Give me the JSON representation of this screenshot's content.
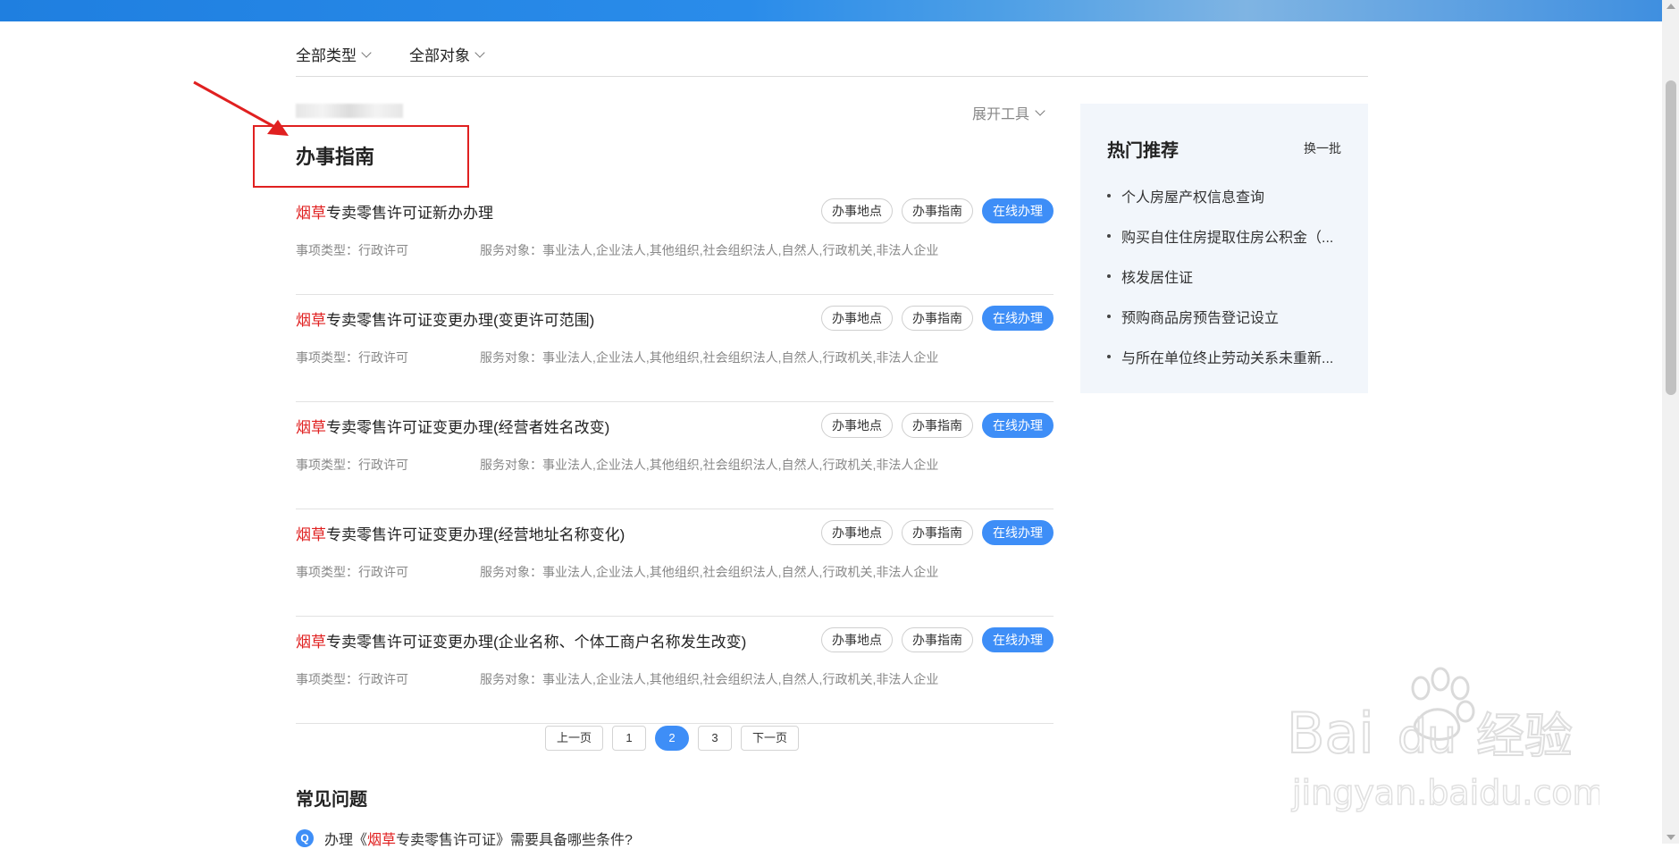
{
  "filters": [
    {
      "label": "全部类型"
    },
    {
      "label": "全部对象"
    }
  ],
  "toolbar": {
    "expand_tools": "展开工具"
  },
  "section": {
    "title": "办事指南"
  },
  "items": [
    {
      "keyword": "烟草",
      "rest": "专卖零售许可证新办办理",
      "type": "事项类型：行政许可",
      "target": "服务对象：事业法人,企业法人,其他组织,社会组织法人,自然人,行政机关,非法人企业"
    },
    {
      "keyword": "烟草",
      "rest": "专卖零售许可证变更办理(变更许可范围)",
      "type": "事项类型：行政许可",
      "target": "服务对象：事业法人,企业法人,其他组织,社会组织法人,自然人,行政机关,非法人企业"
    },
    {
      "keyword": "烟草",
      "rest": "专卖零售许可证变更办理(经营者姓名改变)",
      "type": "事项类型：行政许可",
      "target": "服务对象：事业法人,企业法人,其他组织,社会组织法人,自然人,行政机关,非法人企业"
    },
    {
      "keyword": "烟草",
      "rest": "专卖零售许可证变更办理(经营地址名称变化)",
      "type": "事项类型：行政许可",
      "target": "服务对象：事业法人,企业法人,其他组织,社会组织法人,自然人,行政机关,非法人企业"
    },
    {
      "keyword": "烟草",
      "rest": "专卖零售许可证变更办理(企业名称、个体工商户名称发生改变)",
      "type": "事项类型：行政许可",
      "target": "服务对象：事业法人,企业法人,其他组织,社会组织法人,自然人,行政机关,非法人企业"
    }
  ],
  "buttons": {
    "location": "办事地点",
    "guide": "办事指南",
    "online": "在线办理"
  },
  "pager": {
    "prev": "上一页",
    "pages": [
      "1",
      "2",
      "3"
    ],
    "active": "2",
    "next": "下一页"
  },
  "faq": {
    "title": "常见问题",
    "q_icon": "Q",
    "question_prefix": "办理《",
    "question_keyword": "烟草",
    "question_suffix": "专卖零售许可证》需要具备哪些条件?"
  },
  "hot": {
    "title": "热门推荐",
    "refresh": "换一批",
    "items": [
      "个人房屋产权信息查询",
      "购买自住住房提取住房公积金（...",
      "核发居住证",
      "预购商品房预告登记设立",
      "与所在单位终止劳动关系未重新..."
    ]
  },
  "watermark": {
    "brand": "Bai",
    "brand2": "du",
    "cn": "经验",
    "url": "jingyan.baidu.com"
  },
  "colors": {
    "accent": "#3e8ef7",
    "keyword": "#e02020",
    "annotation": "#e02020"
  }
}
